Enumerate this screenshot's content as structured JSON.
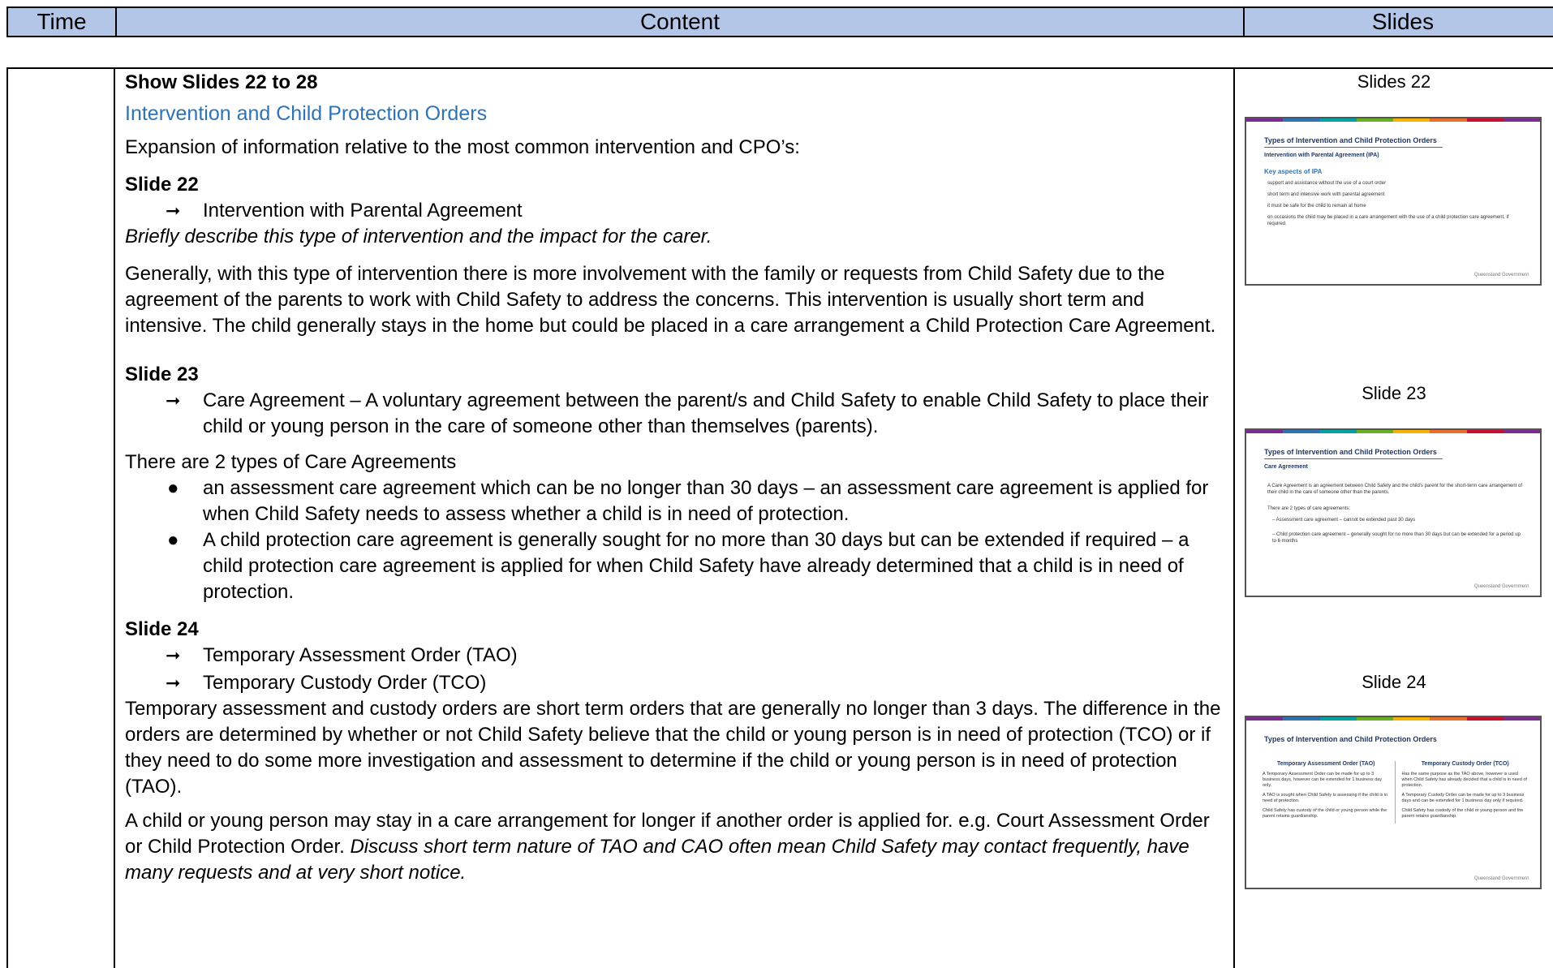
{
  "header": {
    "time": "Time",
    "content": "Content",
    "slides": "Slides"
  },
  "content": {
    "show_slides": "Show Slides 22 to 28",
    "section_title": "Intervention and Child Protection Orders",
    "intro": "Expansion of information relative to the most common intervention and CPO’s:",
    "slide22": {
      "heading": "Slide 22",
      "arrow1": "Intervention with Parental Agreement",
      "italic": "Briefly describe this type of intervention and the impact for the carer.",
      "para": "Generally, with this type of intervention there is more involvement with the family or requests from Child Safety due to the agreement of the parents to work with Child Safety to address the concerns. This intervention is usually short term and intensive. The child generally stays in the home but could be placed in a care arrangement a Child Protection Care Agreement."
    },
    "slide23": {
      "heading": "Slide 23",
      "arrow1": "Care Agreement – A voluntary agreement between the parent/s and Child Safety to enable Child Safety to place their child or young person in the care of someone other than themselves (parents).",
      "types_intro": "There are 2 types of Care Agreements",
      "bullet1": "an assessment care agreement which can be no longer than 30 days – an assessment care agreement is applied for when Child Safety needs to assess whether a child is in need of protection.",
      "bullet2": "A child protection care agreement is generally sought for no more than 30 days but can be extended if required – a child protection care agreement is applied for when Child Safety have already determined that a child is in need of protection."
    },
    "slide24": {
      "heading": "Slide 24",
      "arrow1": "Temporary Assessment Order (TAO)",
      "arrow2": "Temporary Custody Order (TCO)",
      "para1": "Temporary assessment and custody orders are short term orders that are generally no longer than 3 days.  The difference in the orders are determined by whether or not Child Safety believe that the child or young person is in need of protection (TCO) or if they need to do some more investigation and assessment to determine if the child or young person is in need of protection (TAO).",
      "para2_normal": "A child or young person may stay in a care arrangement for longer if another order is applied for. e.g. Court Assessment Order or Child Protection Order.  ",
      "para2_italic": "Discuss short term nature of TAO and CAO often mean Child Safety may contact frequently, have many requests and at very short notice."
    }
  },
  "slides": {
    "label22": "Slides 22",
    "label23": "Slide 23",
    "label24": "Slide 24",
    "common_title": "Types of Intervention and Child Protection Orders",
    "logo": "Queensland Government",
    "thumb22": {
      "subtitle": "Intervention with Parental Agreement (IPA)",
      "blue": "Key aspects of IPA",
      "lines": [
        "support and assistance without the use of a court order",
        "short term and intensive work with parental agreement",
        "it must be safe for the child to remain at home",
        "on occasions the child may be placed in a care arrangement with the use of a child protection care agreement, if required."
      ]
    },
    "thumb23": {
      "subtitle": "Care Agreement",
      "lines": [
        "A Care Agreement is an agreement between Child Safety and the child's parent for the short-term care arrangement of their child in the care of someone other than the parents.",
        "There are 2 types of care agreements:",
        "– Assessment care agreement – cannot be extended past 30 days",
        "– Child protection care agreement – generally sought for no more than 30 days but can be extended for a period up to 6 months"
      ]
    },
    "thumb24": {
      "col1_head": "Temporary Assessment Order (TAO)",
      "col1_lines": [
        "A Temporary Assessment Order can be made for up to 3 business days, however can be extended for 1 business day only.",
        "A TAO is sought when Child Safety is assessing if the child is in need of protection.",
        "Child Safety has custody of the child or young person while the parent retains guardianship."
      ],
      "col2_head": "Temporary Custody Order (TCO)",
      "col2_lines": [
        "Has the same purpose as the TAO above, however is used when Child Safety has already decided that a child is in need of protection.",
        "A Temporary Custody Order can be made for up to 3 business days and can be extended for 1 business day only if required.",
        "Child Safety has custody of the child or young person and the parent retains guardianship."
      ]
    }
  }
}
